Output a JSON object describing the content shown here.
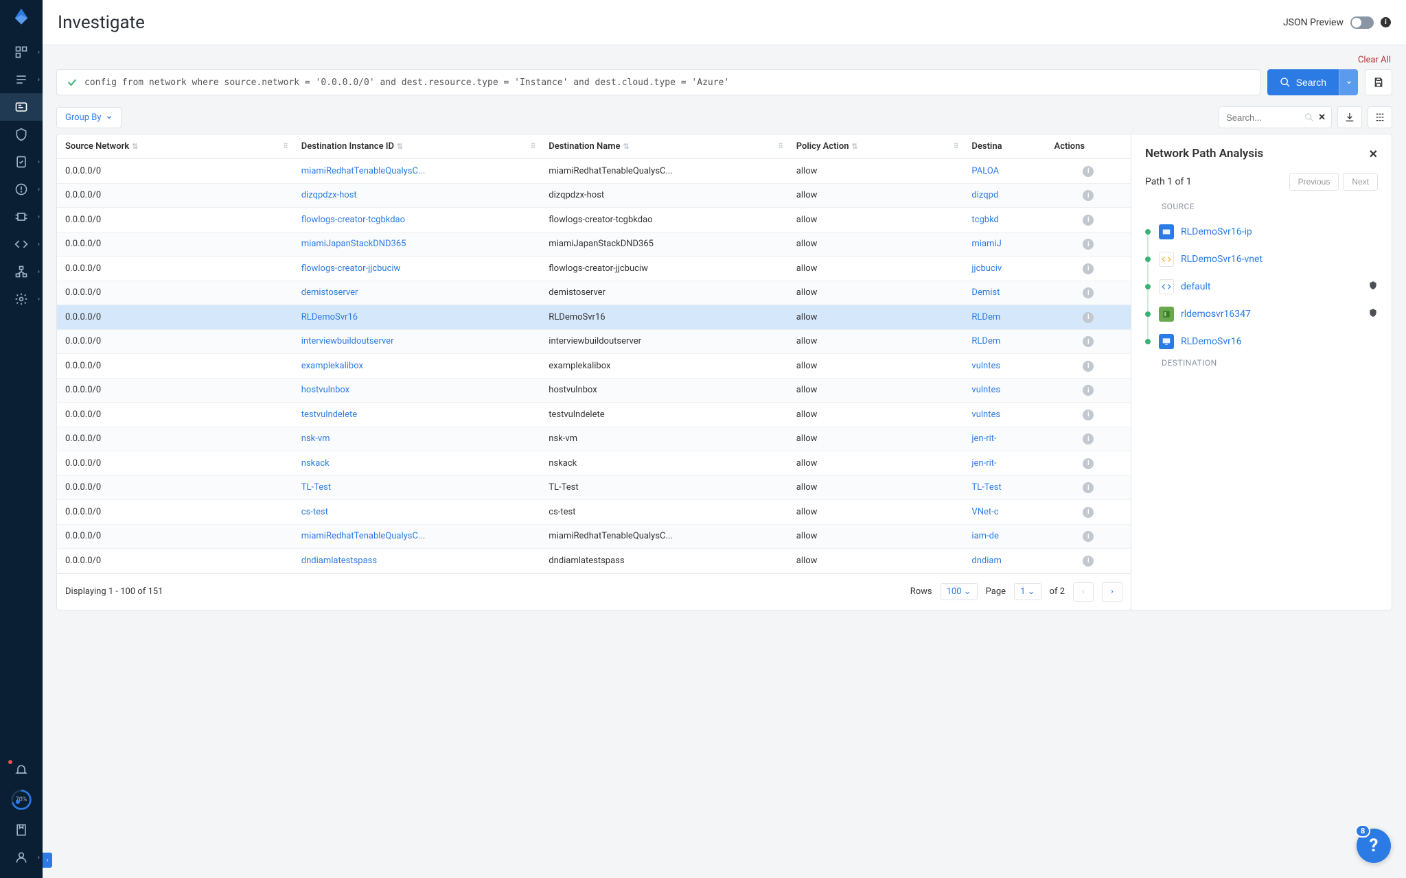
{
  "header": {
    "title": "Investigate",
    "json_preview_label": "JSON Preview"
  },
  "clear_all_label": "Clear All",
  "query": "config from network where source.network = '0.0.0.0/0' and dest.resource.type = 'Instance' and dest.cloud.type = 'Azure'",
  "search_button": "Search",
  "groupby_label": "Group By",
  "table_search_placeholder": "Search...",
  "columns": {
    "source_network": "Source Network",
    "dest_instance_id": "Destination Instance ID",
    "dest_name": "Destination Name",
    "policy_action": "Policy Action",
    "dest_resource": "Destina",
    "actions": "Actions"
  },
  "rows": [
    {
      "src": "0.0.0.0/0",
      "did": "miamiRedhatTenableQualysC...",
      "dname": "miamiRedhatTenableQualysC...",
      "pol": "allow",
      "dres": "PALOA"
    },
    {
      "src": "0.0.0.0/0",
      "did": "dizqpdzx-host",
      "dname": "dizqpdzx-host",
      "pol": "allow",
      "dres": "dizqpd"
    },
    {
      "src": "0.0.0.0/0",
      "did": "flowlogs-creator-tcgbkdao",
      "dname": "flowlogs-creator-tcgbkdao",
      "pol": "allow",
      "dres": "tcgbkd"
    },
    {
      "src": "0.0.0.0/0",
      "did": "miamiJapanStackDND365",
      "dname": "miamiJapanStackDND365",
      "pol": "allow",
      "dres": "miamiJ"
    },
    {
      "src": "0.0.0.0/0",
      "did": "flowlogs-creator-jjcbuciw",
      "dname": "flowlogs-creator-jjcbuciw",
      "pol": "allow",
      "dres": "jjcbuciv"
    },
    {
      "src": "0.0.0.0/0",
      "did": "demistoserver",
      "dname": "demistoserver",
      "pol": "allow",
      "dres": "Demist"
    },
    {
      "src": "0.0.0.0/0",
      "did": "RLDemoSvr16",
      "dname": "RLDemoSvr16",
      "pol": "allow",
      "dres": "RLDem",
      "selected": true
    },
    {
      "src": "0.0.0.0/0",
      "did": "interviewbuildoutserver",
      "dname": "interviewbuildoutserver",
      "pol": "allow",
      "dres": "RLDem"
    },
    {
      "src": "0.0.0.0/0",
      "did": "examplekalibox",
      "dname": "examplekalibox",
      "pol": "allow",
      "dres": "vulntes"
    },
    {
      "src": "0.0.0.0/0",
      "did": "hostvulnbox",
      "dname": "hostvulnbox",
      "pol": "allow",
      "dres": "vulntes"
    },
    {
      "src": "0.0.0.0/0",
      "did": "testvulndelete",
      "dname": "testvulndelete",
      "pol": "allow",
      "dres": "vulntes"
    },
    {
      "src": "0.0.0.0/0",
      "did": "nsk-vm",
      "dname": "nsk-vm",
      "pol": "allow",
      "dres": "jen-rit-"
    },
    {
      "src": "0.0.0.0/0",
      "did": "nskack",
      "dname": "nskack",
      "pol": "allow",
      "dres": "jen-rit-"
    },
    {
      "src": "0.0.0.0/0",
      "did": "TL-Test",
      "dname": "TL-Test",
      "pol": "allow",
      "dres": "TL-Test"
    },
    {
      "src": "0.0.0.0/0",
      "did": "cs-test",
      "dname": "cs-test",
      "pol": "allow",
      "dres": "VNet-c"
    },
    {
      "src": "0.0.0.0/0",
      "did": "miamiRedhatTenableQualysC...",
      "dname": "miamiRedhatTenableQualysC...",
      "pol": "allow",
      "dres": "iam-de"
    },
    {
      "src": "0.0.0.0/0",
      "did": "dndiamlatestspass",
      "dname": "dndiamlatestspass",
      "pol": "allow",
      "dres": "dndiam"
    }
  ],
  "pager": {
    "displaying": "Displaying 1 - 100 of 151",
    "rows_label": "Rows",
    "rows_value": "100",
    "page_label": "Page",
    "page_value": "1",
    "of_label": "of 2"
  },
  "panel": {
    "title": "Network Path Analysis",
    "path_label": "Path 1 of 1",
    "prev": "Previous",
    "next": "Next",
    "source_label": "SOURCE",
    "dest_label": "DESTINATION",
    "hops": [
      {
        "name": "RLDemoSvr16-ip",
        "icon_bg": "#2c7be5",
        "icon": "ip",
        "shield": false
      },
      {
        "name": "RLDemoSvr16-vnet",
        "icon_bg": "#ffffff",
        "icon": "vnet",
        "shield": false
      },
      {
        "name": "default",
        "icon_bg": "#ffffff",
        "icon": "subnet",
        "shield": true
      },
      {
        "name": "rldemosvr16347",
        "icon_bg": "#6aa84f",
        "icon": "nic",
        "shield": true
      },
      {
        "name": "RLDemoSvr16",
        "icon_bg": "#2c7be5",
        "icon": "vm",
        "shield": false
      }
    ]
  },
  "help_badge": "8",
  "progress_pct": "70%"
}
